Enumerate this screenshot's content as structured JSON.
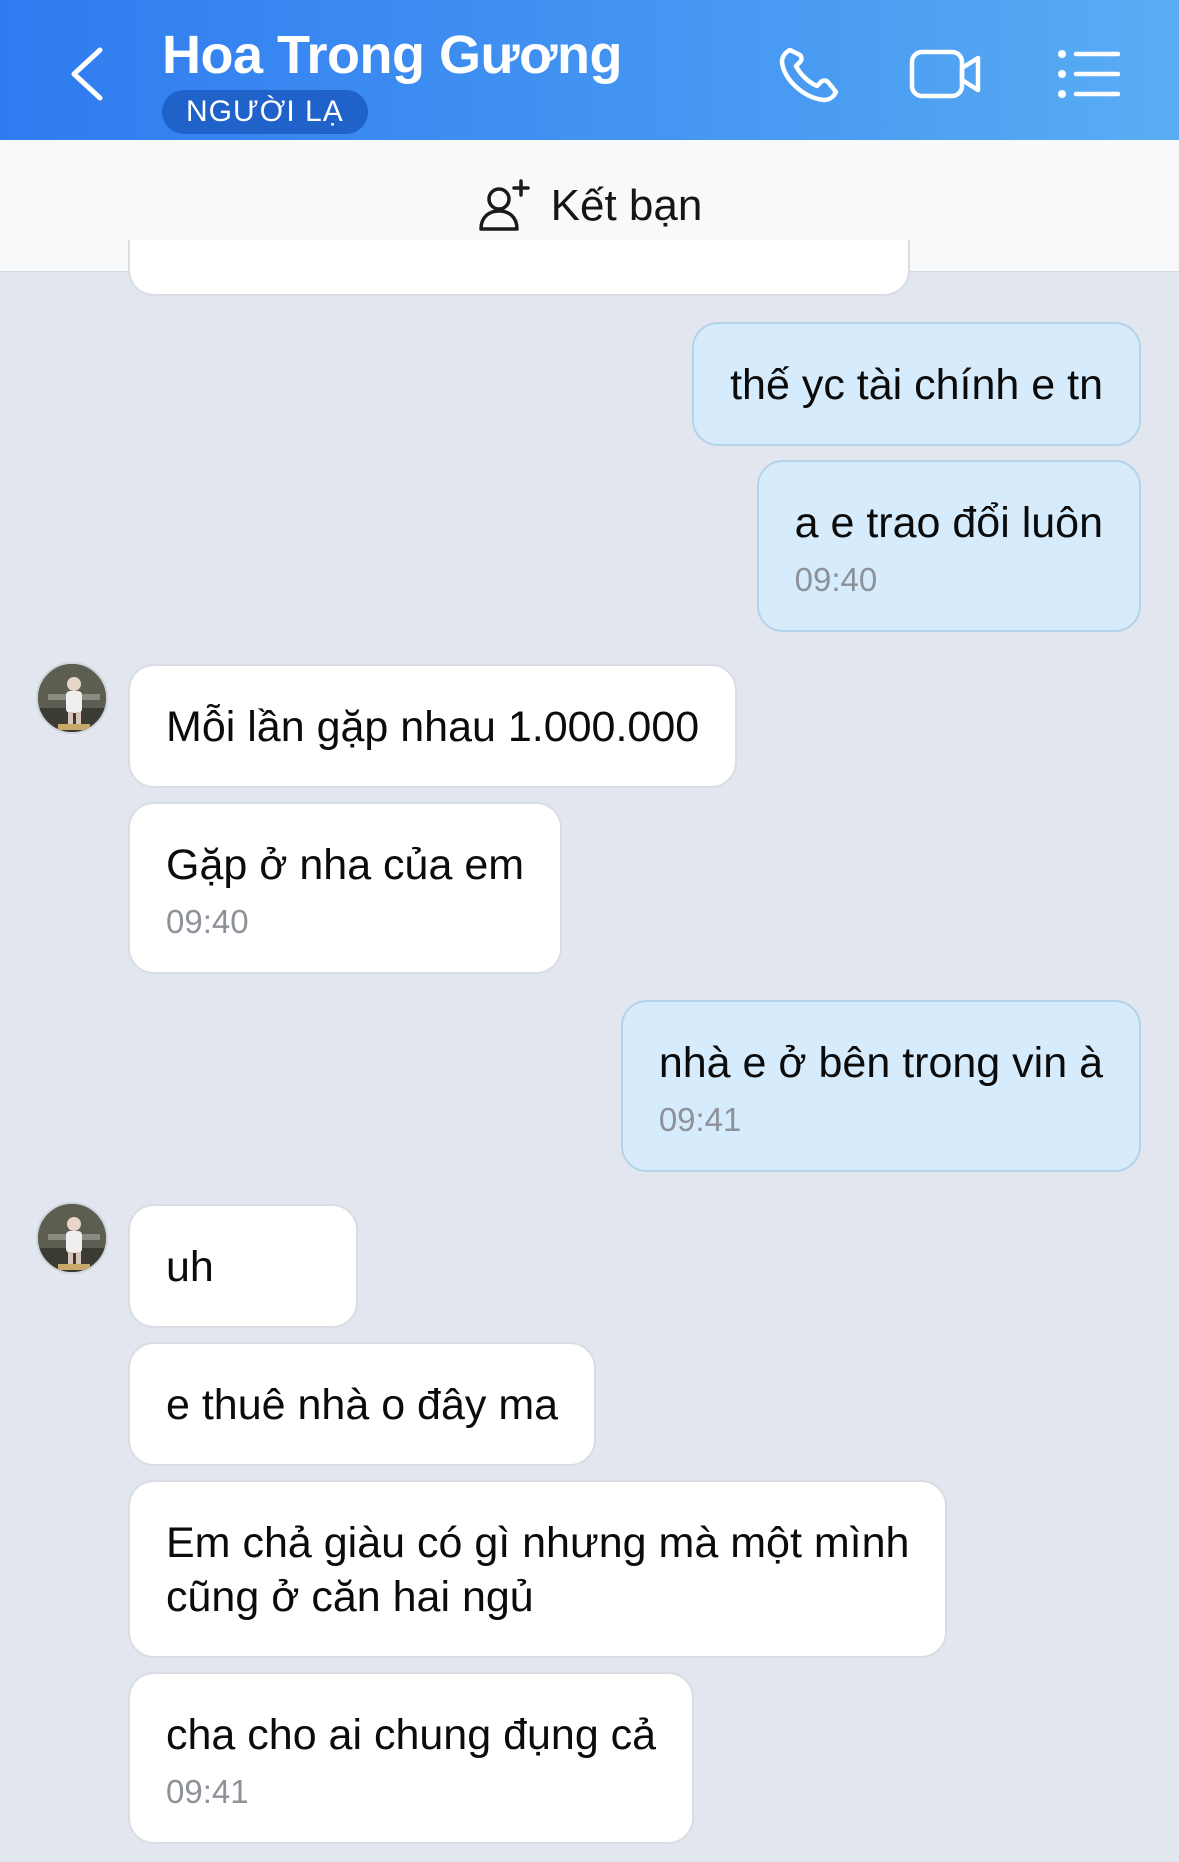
{
  "header": {
    "contact_name": "Hoa Trong Gương",
    "badge": "NGƯỜI LẠ",
    "back_icon": "chevron-left-icon",
    "call_icon": "phone-icon",
    "video_icon": "video-camera-icon",
    "menu_icon": "list-menu-icon"
  },
  "friend_bar": {
    "label": "Kết bạn",
    "icon": "add-person-icon"
  },
  "colors": {
    "header_start": "#2f7bf0",
    "header_end": "#5aadf3",
    "outgoing_bubble": "#d6ebfb",
    "incoming_bubble": "#ffffff",
    "chat_background": "#e2e6ee"
  },
  "messages": [
    {
      "direction": "out",
      "text": "thế yc tài chính e tn",
      "time": ""
    },
    {
      "direction": "out",
      "text": "a e trao đổi luôn",
      "time": "09:40"
    },
    {
      "direction": "in",
      "text": "Mỗi lần gặp nhau 1.000.000",
      "time": ""
    },
    {
      "direction": "in",
      "text": "Gặp ở nha của em",
      "time": "09:40"
    },
    {
      "direction": "out",
      "text": "nhà e ở bên trong vin à",
      "time": "09:41"
    },
    {
      "direction": "in",
      "text": "uh",
      "time": ""
    },
    {
      "direction": "in",
      "text": "e thuê nhà o đây ma",
      "time": ""
    },
    {
      "direction": "in",
      "text": "Em chả giàu có gì nhưng mà một mình",
      "text2": "cũng ở căn hai ngủ",
      "time": ""
    },
    {
      "direction": "in",
      "text": "cha cho ai chung đụng cả",
      "time": "09:41"
    }
  ]
}
